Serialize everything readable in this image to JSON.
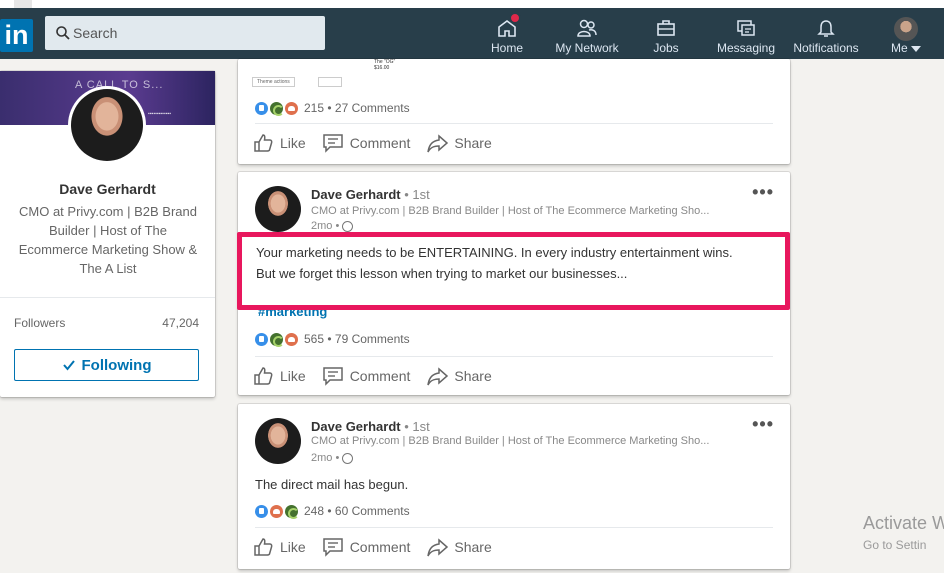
{
  "nav": {
    "logo_text": "in",
    "search_placeholder": "Search",
    "items": [
      {
        "label": "Home",
        "icon": "home-icon"
      },
      {
        "label": "My Network",
        "icon": "network-icon"
      },
      {
        "label": "Jobs",
        "icon": "briefcase-icon"
      },
      {
        "label": "Messaging",
        "icon": "messaging-icon"
      },
      {
        "label": "Notifications",
        "icon": "bell-icon"
      },
      {
        "label": "Me",
        "icon": "avatar"
      }
    ],
    "colors": {
      "bar": "#283e4a",
      "badge": "#e0284a",
      "logo": "#0073b1"
    }
  },
  "profile": {
    "banner_text": "A CALL TO S...",
    "name": "Dave Gerhardt",
    "headline": "CMO at Privy.com | B2B Brand Builder | Host of The Ecommerce Marketing Show & The A List",
    "followers_label": "Followers",
    "followers_count": "47,204",
    "following_button": "Following"
  },
  "preview": {
    "toolbar_label": "Theme actions",
    "note_line1": "The \"OG\"",
    "note_line2": "$16.00"
  },
  "posts": [
    {
      "reaction_summary": "215 • 27 Comments",
      "actions": {
        "like": "Like",
        "comment": "Comment",
        "share": "Share"
      }
    },
    {
      "author": "Dave Gerhardt",
      "degree": "• 1st",
      "headline": "CMO at Privy.com | B2B Brand Builder | Host of The Ecommerce Marketing Sho...",
      "time": "2mo •",
      "text_line1": "Your marketing needs to be ENTERTAINING. In every industry entertainment wins.",
      "text_line2": "But we forget this lesson when trying to market our businesses...",
      "hashtag": "#marketing",
      "reaction_summary": "565 • 79 Comments",
      "actions": {
        "like": "Like",
        "comment": "Comment",
        "share": "Share"
      }
    },
    {
      "author": "Dave Gerhardt",
      "degree": "• 1st",
      "headline": "CMO at Privy.com | B2B Brand Builder | Host of The Ecommerce Marketing Sho...",
      "time": "2mo •",
      "text": "The direct mail has begun.",
      "reaction_summary": "248 • 60 Comments",
      "actions": {
        "like": "Like",
        "comment": "Comment",
        "share": "Share"
      }
    }
  ],
  "more_glyph": "•••",
  "highlight_color": "#e8175d",
  "watermark": {
    "line1": "Activate W",
    "line2": "Go to Settin"
  }
}
